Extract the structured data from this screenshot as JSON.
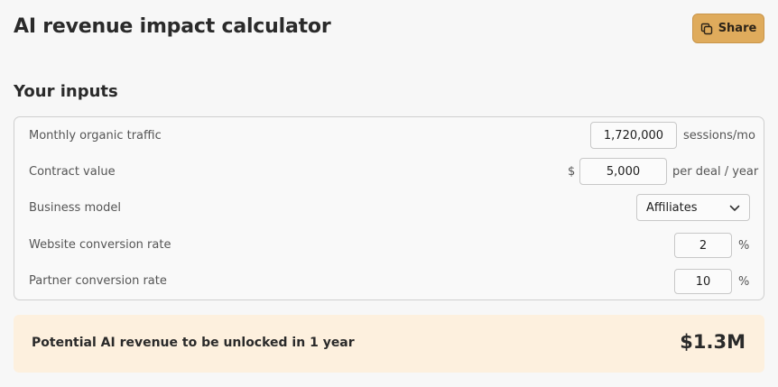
{
  "header": {
    "title": "AI revenue impact calculator",
    "share_label": "Share",
    "share_icon": "copy-icon",
    "accent_color": "#dfab5c"
  },
  "inputs": {
    "section_title": "Your inputs",
    "monthly_traffic": {
      "label": "Monthly organic traffic",
      "value": "1,720,000",
      "unit": "sessions/mo"
    },
    "contract_value": {
      "label": "Contract value",
      "prefix": "$",
      "value": "5,000",
      "unit": "per deal / year"
    },
    "business_model": {
      "label": "Business model",
      "selected": "Affiliates",
      "icon": "chevron-down-icon"
    },
    "website_conversion": {
      "label": "Website conversion rate",
      "value": "2",
      "unit": "%"
    },
    "partner_conversion": {
      "label": "Partner conversion rate",
      "value": "10",
      "unit": "%"
    }
  },
  "result": {
    "label": "Potential AI revenue to be unlocked in 1 year",
    "value": "$1.3M",
    "background_color": "#fdf0de"
  }
}
